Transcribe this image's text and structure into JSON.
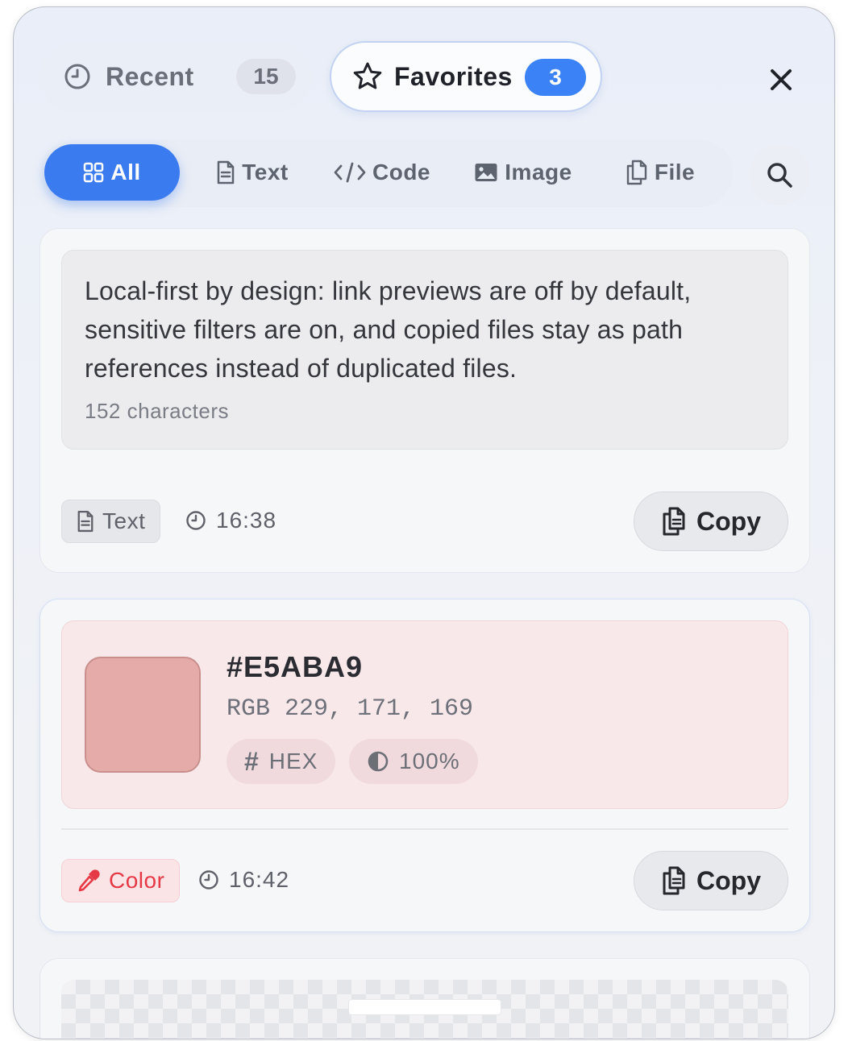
{
  "tabs": {
    "recent": {
      "label": "Recent",
      "count": "15"
    },
    "favorites": {
      "label": "Favorites",
      "count": "3"
    }
  },
  "filters": [
    {
      "label": "All",
      "icon": "grid-icon",
      "active": true
    },
    {
      "label": "Text",
      "icon": "document-icon",
      "active": false
    },
    {
      "label": "Code",
      "icon": "code-icon",
      "active": false
    },
    {
      "label": "Image",
      "icon": "image-icon",
      "active": false
    },
    {
      "label": "File",
      "icon": "files-icon",
      "active": false
    }
  ],
  "cards": {
    "text_card": {
      "body": "Local-first by design: link previews are off by default, sensitive filters are on, and copied files stay as path references instead of duplicated files.",
      "meta": "152 characters",
      "tag": "Text",
      "time": "16:38",
      "copy_label": "Copy"
    },
    "color_card": {
      "hex": "#E5ABA9",
      "rgb": "RGB 229, 171, 169",
      "format_pill": "HEX",
      "opacity_pill": "100%",
      "swatch_color": "#E5ABA9",
      "tag": "Color",
      "time": "16:42",
      "copy_label": "Copy"
    }
  },
  "colors": {
    "accent": "#3B7BF0",
    "color_tag": "#E53945"
  }
}
